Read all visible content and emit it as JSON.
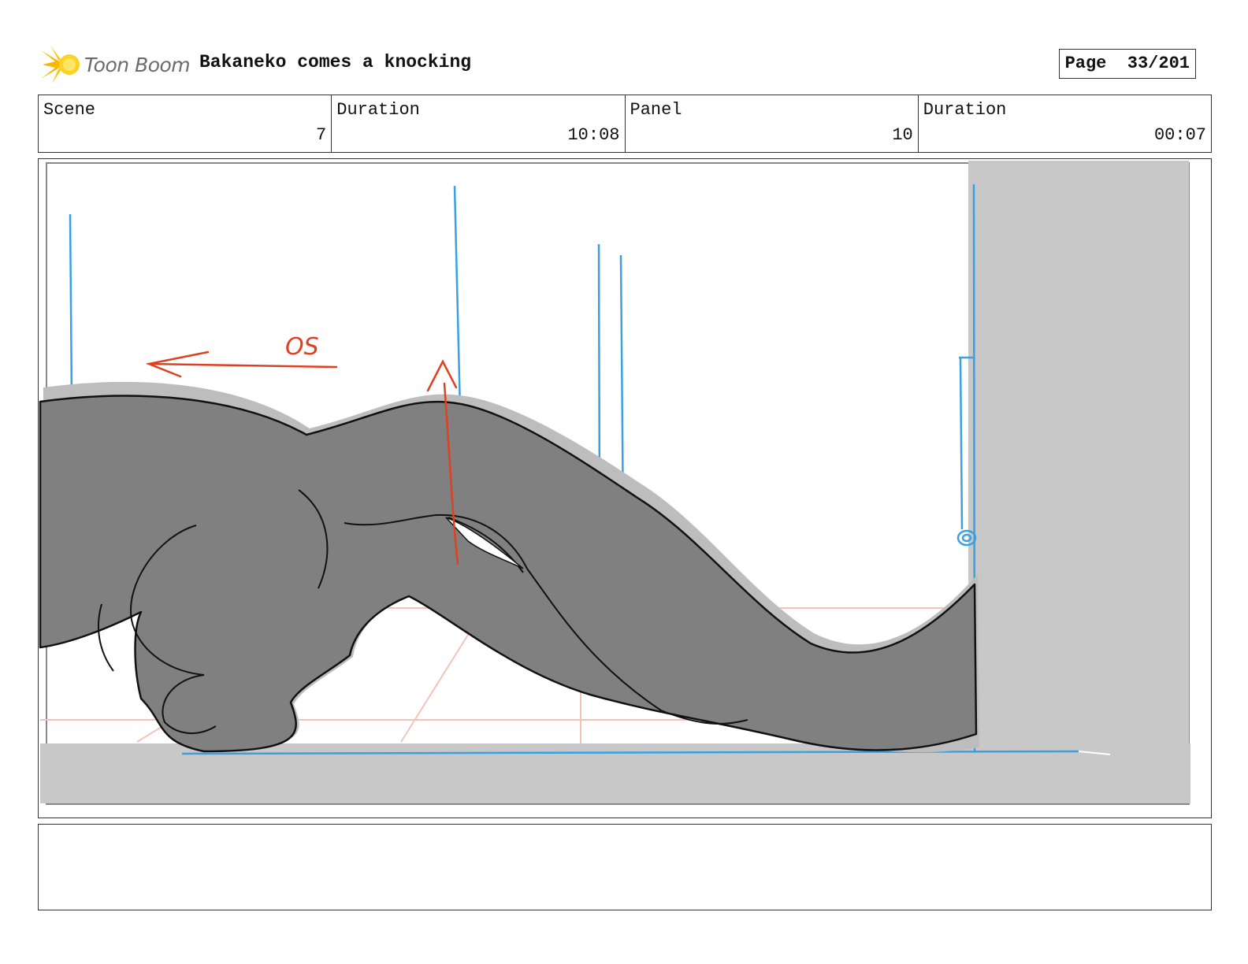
{
  "header": {
    "logo_text": "Toon Boom",
    "title": "Bakaneko comes a knocking",
    "page_label": "Page",
    "page_number": "33/201"
  },
  "info": {
    "scene_label": "Scene",
    "scene_value": "7",
    "scene_duration_label": "Duration",
    "scene_duration_value": "10:08",
    "panel_label": "Panel",
    "panel_value": "10",
    "panel_duration_label": "Duration",
    "panel_duration_value": "00:07"
  },
  "panel": {
    "annotation": "OS",
    "colors": {
      "layout_line": "#3aa0e0",
      "direction_arrow": "#e0401f",
      "creature_fill": "#808080",
      "shadow": "#c8c8c8",
      "floor_grid": "#f2c4b8"
    }
  }
}
